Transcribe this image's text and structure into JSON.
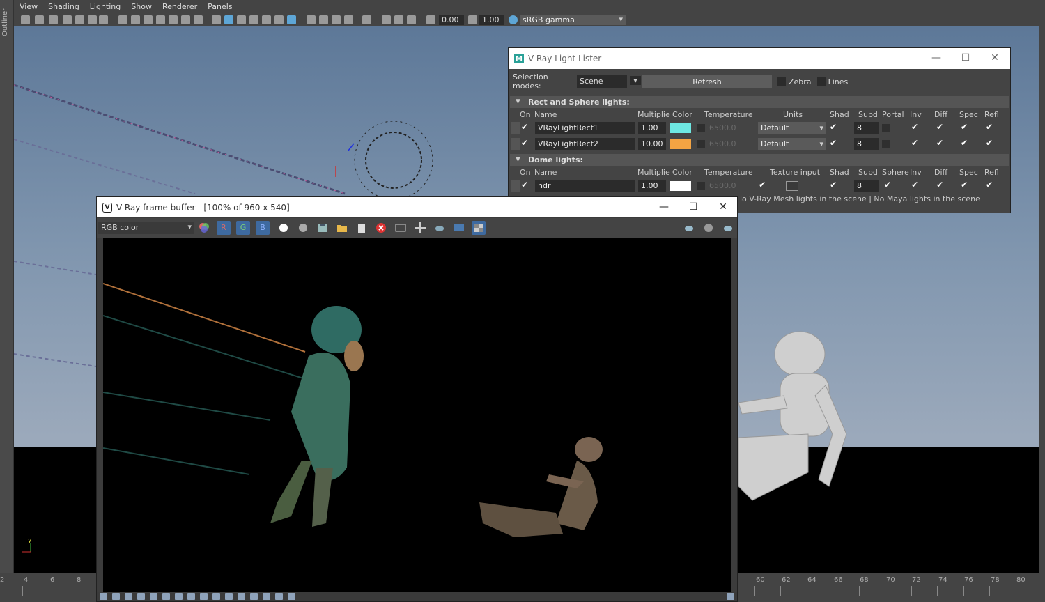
{
  "outliner": {
    "label": "Outliner"
  },
  "viewport_menu": [
    "View",
    "Shading",
    "Lighting",
    "Show",
    "Renderer",
    "Panels"
  ],
  "viewport_toolbar": {
    "exposure": "0.00",
    "gamma": "1.00",
    "color_space": "sRGB gamma"
  },
  "timeline": {
    "left_ticks": [
      "2",
      "4",
      "6",
      "8"
    ],
    "right_ticks": [
      "60",
      "62",
      "64",
      "66",
      "68",
      "70",
      "72",
      "74",
      "76",
      "78",
      "80"
    ]
  },
  "light_lister": {
    "title": "V-Ray Light Lister",
    "selection_label": "Selection modes:",
    "selection_value": "Scene",
    "refresh_label": "Refresh",
    "zebra_label": "Zebra",
    "lines_label": "Lines",
    "rect_section": "Rect and Sphere lights:",
    "rect_columns": [
      "On",
      "Name",
      "Multiplie",
      "Color",
      "Temperature",
      "Units",
      "Shad",
      "Subd",
      "Portal",
      "Inv",
      "Diff",
      "Spec",
      "Refl"
    ],
    "rect_lights": [
      {
        "name": "VRayLightRect1",
        "multiplier": "1.00",
        "color": "#6ee8e2",
        "temperature": "6500.0",
        "units": "Default",
        "subdivs": "8"
      },
      {
        "name": "VRayLightRect2",
        "multiplier": "10.00",
        "color": "#f4a443",
        "temperature": "6500.0",
        "units": "Default",
        "subdivs": "8"
      }
    ],
    "dome_section": "Dome lights:",
    "dome_columns": [
      "On",
      "Name",
      "Multiplie",
      "Color",
      "Temperature",
      "Texture input",
      "Shad",
      "Subd",
      "Sphere",
      "Inv",
      "Diff",
      "Spec",
      "Refl"
    ],
    "dome_lights": [
      {
        "name": "hdr",
        "multiplier": "1.00",
        "color": "#ffffff",
        "temperature": "6500.0",
        "subdivs": "8"
      }
    ],
    "status": "lo V-Ray Mesh lights in the scene | No Maya lights in the scene"
  },
  "frame_buffer": {
    "title": "V-Ray frame buffer - [100% of 960 x 540]",
    "channel": "RGB color",
    "channel_buttons": [
      "R",
      "G",
      "B"
    ]
  },
  "icons": [
    "minimize-icon",
    "maximize-icon",
    "close-icon",
    "check-icon",
    "save-icon",
    "folder-icon",
    "stop-icon",
    "teapot-icon"
  ]
}
